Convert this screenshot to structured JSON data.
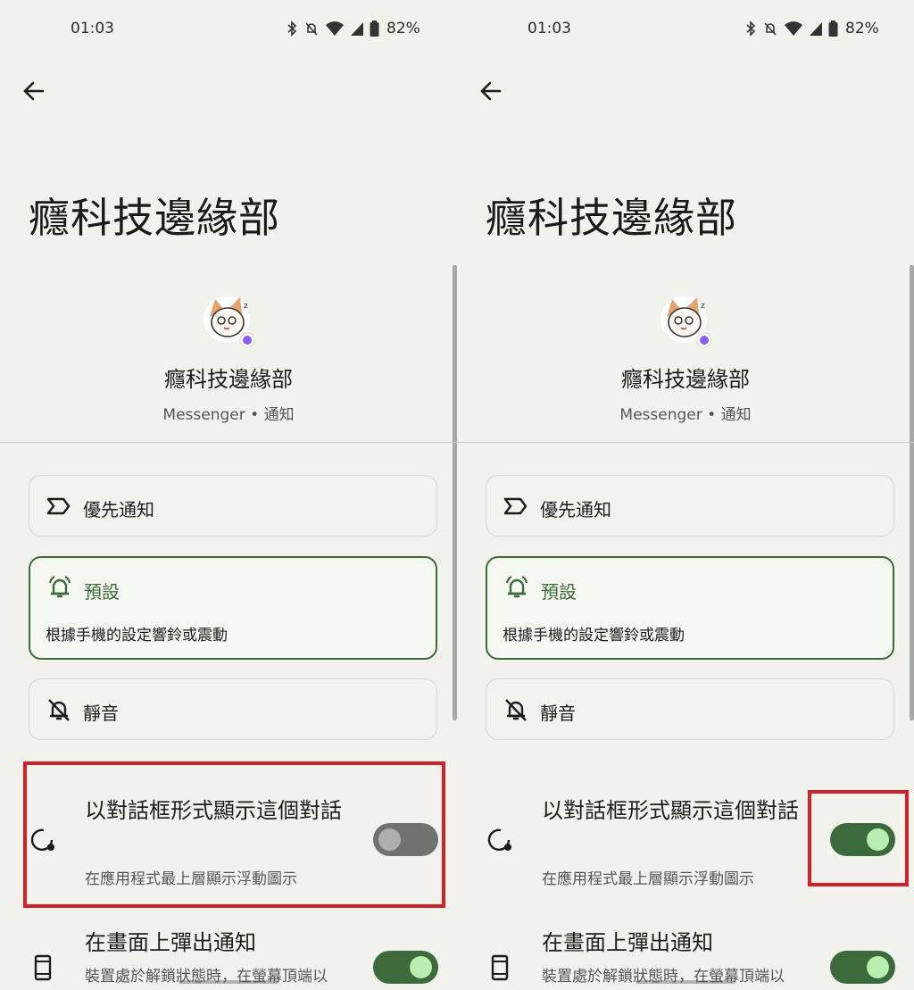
{
  "status_bar": {
    "time": "01:03",
    "battery": "82%"
  },
  "page_title": "癮科技邊緣部",
  "conversation": {
    "name": "癮科技邊緣部",
    "subtitle": "Messenger • 通知"
  },
  "options": {
    "priority": {
      "label": "優先通知"
    },
    "default": {
      "label": "預設",
      "description": "根據手機的設定響鈴或震動"
    },
    "silent": {
      "label": "靜音"
    }
  },
  "settings": {
    "bubble": {
      "title": "以對話框形式顯示這個對話",
      "subtitle": "在應用程式最上層顯示浮動圖示"
    },
    "popup": {
      "title": "在畫面上彈出通知",
      "subtitle": "裝置處於解鎖狀態時，在螢幕頂端以"
    }
  },
  "state": {
    "left": {
      "bubble_enabled": false,
      "popup_enabled": true
    },
    "right": {
      "bubble_enabled": true,
      "popup_enabled": true
    }
  },
  "colors": {
    "accent_green": "#3d6a3c",
    "highlight_red": "#d3212b",
    "background": "#f2f2ec"
  },
  "icons": [
    "back-arrow-icon",
    "bluetooth-icon",
    "mute-bell-icon",
    "wifi-icon",
    "cell-signal-icon",
    "battery-icon",
    "priority-icon",
    "bell-ring-icon",
    "bell-off-icon",
    "bubble-icon",
    "phone-icon"
  ]
}
